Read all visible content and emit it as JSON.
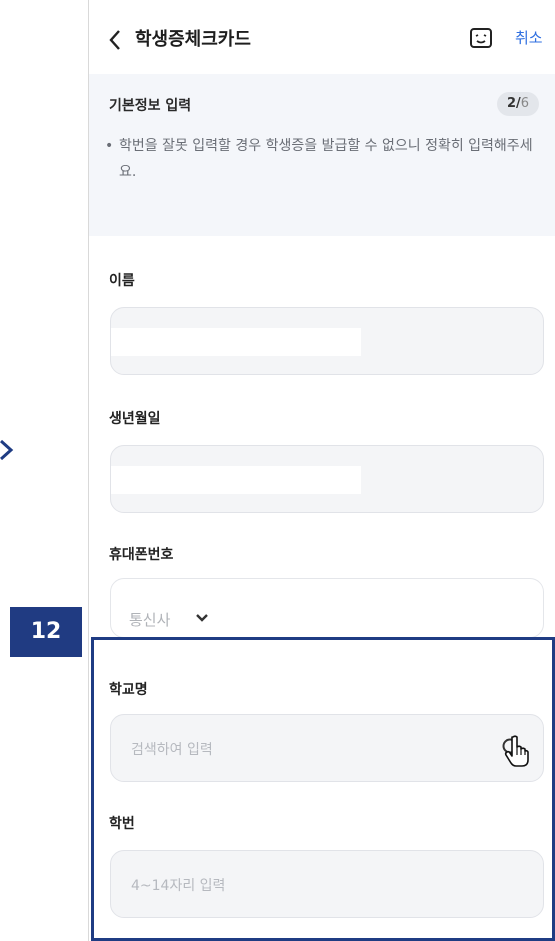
{
  "header": {
    "title": "학생증체크카드",
    "cancel_label": "취소"
  },
  "info": {
    "section_title": "기본정보 입력",
    "step_current": "2",
    "step_separator": "/",
    "step_total": "6",
    "notice": "학번을 잘못 입력할 경우 학생증을 발급할 수 없으니 정확히 입력해주세요."
  },
  "form": {
    "name_label": "이름",
    "birth_label": "생년월일",
    "phone_label": "휴대폰번호",
    "carrier_placeholder": "통신사",
    "school_label": "학교명",
    "school_placeholder": "검색하여 입력",
    "student_id_label": "학번",
    "student_id_placeholder": "4~14자리 입력"
  },
  "annotation": {
    "step_number": "12",
    "highlight_color": "#1f3c83"
  },
  "colors": {
    "accent": "#2f6fe0",
    "panel_bg": "#f4f6fa",
    "input_bg": "#f4f5f7"
  },
  "icons": [
    "chevron-left-icon",
    "emoji-icon",
    "chevron-down-icon",
    "search-icon",
    "hand-cursor-icon",
    "chevron-right-icon"
  ]
}
